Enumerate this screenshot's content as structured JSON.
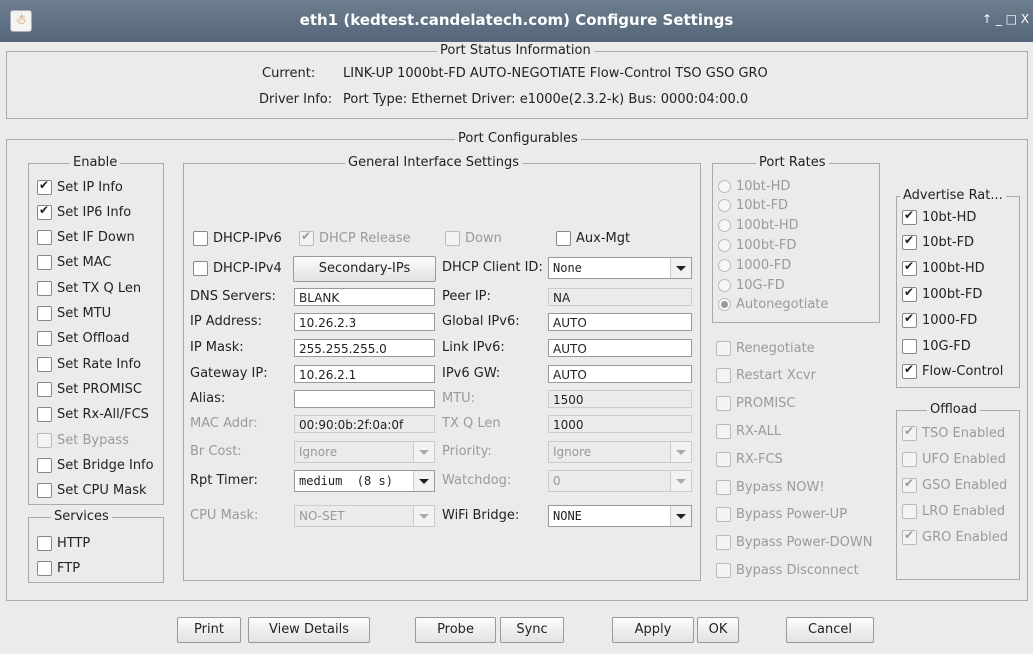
{
  "window": {
    "title": "eth1  (kedtest.candelatech.com) Configure Settings",
    "app_icon": "☃",
    "controls": "↑ _ □ X"
  },
  "status": {
    "header": "Port Status Information",
    "current_label": "Current:",
    "current_value": "LINK-UP 1000bt-FD AUTO-NEGOTIATE Flow-Control TSO GSO GRO",
    "driver_label": "Driver Info:",
    "driver_value": "Port Type: Ethernet   Driver: e1000e(2.3.2-k)  Bus: 0000:04:00.0"
  },
  "configurables": {
    "header": "Port Configurables"
  },
  "enable": {
    "title": "Enable",
    "items": [
      {
        "label": "Set IP Info",
        "checked": true
      },
      {
        "label": "Set IP6 Info",
        "checked": true
      },
      {
        "label": "Set IF Down",
        "checked": false
      },
      {
        "label": "Set MAC",
        "checked": false
      },
      {
        "label": "Set TX Q Len",
        "checked": false
      },
      {
        "label": "Set MTU",
        "checked": false
      },
      {
        "label": "Set Offload",
        "checked": false
      },
      {
        "label": "Set Rate Info",
        "checked": false
      },
      {
        "label": "Set PROMISC",
        "checked": false
      },
      {
        "label": "Set Rx-All/FCS",
        "checked": false
      },
      {
        "label": "Set Bypass",
        "checked": false,
        "disabled": true
      },
      {
        "label": "Set Bridge Info",
        "checked": false
      },
      {
        "label": "Set CPU Mask",
        "checked": false
      }
    ]
  },
  "services": {
    "title": "Services",
    "items": [
      {
        "label": "HTTP",
        "checked": false
      },
      {
        "label": "FTP",
        "checked": false
      }
    ]
  },
  "general": {
    "title": "General Interface Settings",
    "dhcp_ipv6": "DHCP-IPv6",
    "dhcp_release": "DHCP Release",
    "down": "Down",
    "aux_mgt": "Aux-Mgt",
    "dhcp_ipv4": "DHCP-IPv4",
    "secondary_ips": "Secondary-IPs",
    "dhcp_client_id_label": "DHCP Client ID:",
    "dhcp_client_id": "None",
    "dns_label": "DNS Servers:",
    "dns": "BLANK",
    "peer_ip_label": "Peer IP:",
    "peer_ip": "NA",
    "ip_label": "IP Address:",
    "ip": "10.26.2.3",
    "global_ipv6_label": "Global IPv6:",
    "global_ipv6": "AUTO",
    "mask_label": "IP Mask:",
    "mask": "255.255.255.0",
    "link_ipv6_label": "Link IPv6:",
    "link_ipv6": "AUTO",
    "gateway_label": "Gateway IP:",
    "gateway": "10.26.2.1",
    "ipv6_gw_label": "IPv6 GW:",
    "ipv6_gw": "AUTO",
    "alias_label": "Alias:",
    "alias": "",
    "mtu_label": "MTU:",
    "mtu": "1500",
    "mac_label": "MAC Addr:",
    "mac": "00:90:0b:2f:0a:0f",
    "txq_label": "TX Q Len",
    "txq": "1000",
    "br_cost_label": "Br Cost:",
    "br_cost": "Ignore",
    "priority_label": "Priority:",
    "priority": "Ignore",
    "rpt_timer_label": "Rpt Timer:",
    "rpt_timer": "medium  (8 s)",
    "watchdog_label": "Watchdog:",
    "watchdog": "0",
    "cpu_mask_label": "CPU Mask:",
    "cpu_mask": "NO-SET",
    "wifi_bridge_label": "WiFi Bridge:",
    "wifi_bridge": "NONE"
  },
  "port_rates": {
    "title": "Port Rates",
    "items": [
      {
        "label": "10bt-HD",
        "selected": false
      },
      {
        "label": "10bt-FD",
        "selected": false
      },
      {
        "label": "100bt-HD",
        "selected": false
      },
      {
        "label": "100bt-FD",
        "selected": false
      },
      {
        "label": "1000-FD",
        "selected": false
      },
      {
        "label": "10G-FD",
        "selected": false
      },
      {
        "label": "Autonegotiate",
        "selected": true
      }
    ]
  },
  "misc": {
    "items": [
      "Renegotiate",
      "Restart Xcvr",
      "PROMISC",
      "RX-ALL",
      "RX-FCS",
      "Bypass NOW!",
      "Bypass Power-UP",
      "Bypass Power-DOWN",
      "Bypass Disconnect"
    ]
  },
  "advertise": {
    "title": "Advertise Rat...",
    "items": [
      {
        "label": "10bt-HD",
        "checked": true
      },
      {
        "label": "10bt-FD",
        "checked": true
      },
      {
        "label": "100bt-HD",
        "checked": true
      },
      {
        "label": "100bt-FD",
        "checked": true
      },
      {
        "label": "1000-FD",
        "checked": true
      },
      {
        "label": "10G-FD",
        "checked": false
      },
      {
        "label": "Flow-Control",
        "checked": true
      }
    ]
  },
  "offload": {
    "title": "Offload",
    "items": [
      {
        "label": "TSO Enabled",
        "checked": true
      },
      {
        "label": "UFO Enabled",
        "checked": false
      },
      {
        "label": "GSO Enabled",
        "checked": true
      },
      {
        "label": "LRO Enabled",
        "checked": false
      },
      {
        "label": "GRO Enabled",
        "checked": true
      }
    ]
  },
  "buttons": {
    "print": "Print",
    "view_details": "View Details",
    "probe": "Probe",
    "sync": "Sync",
    "apply": "Apply",
    "ok": "OK",
    "cancel": "Cancel"
  }
}
